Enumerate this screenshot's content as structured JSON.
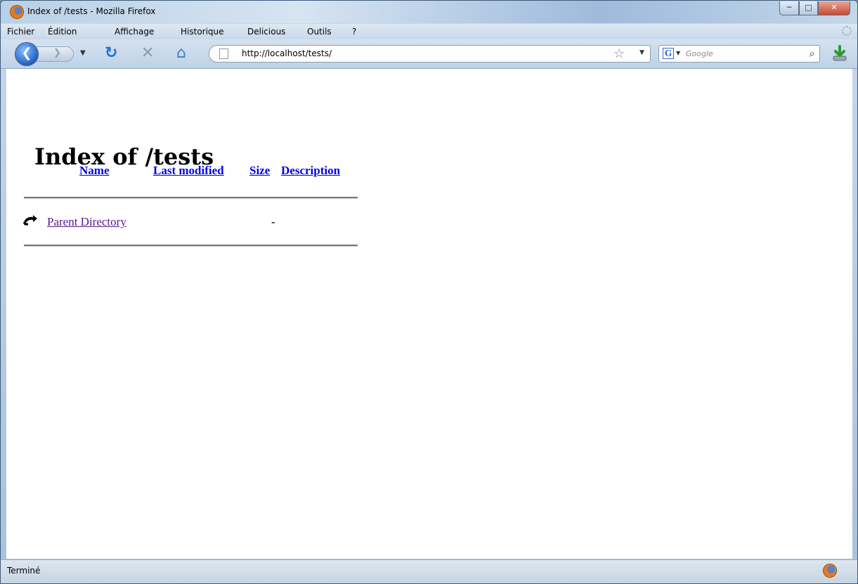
{
  "window": {
    "title": "Index of /tests - Mozilla Firefox"
  },
  "menubar": {
    "items": [
      "Fichier",
      "Édition",
      "Affichage",
      "Historique",
      "Delicious",
      "Outils",
      "?"
    ]
  },
  "navbar": {
    "url": "http://localhost/tests/",
    "search_placeholder": "Google"
  },
  "page": {
    "heading": "Index of /tests",
    "columns": [
      "Name",
      "Last modified",
      "Size",
      "Description"
    ],
    "rows": [
      {
        "name": "Parent Directory",
        "last_modified": "",
        "size": "-",
        "description": ""
      }
    ]
  },
  "status": {
    "text": "Terminé"
  },
  "colors": {
    "link": "#0000ee",
    "visited_link": "#551a8b",
    "chrome": "#c9d9ea"
  }
}
